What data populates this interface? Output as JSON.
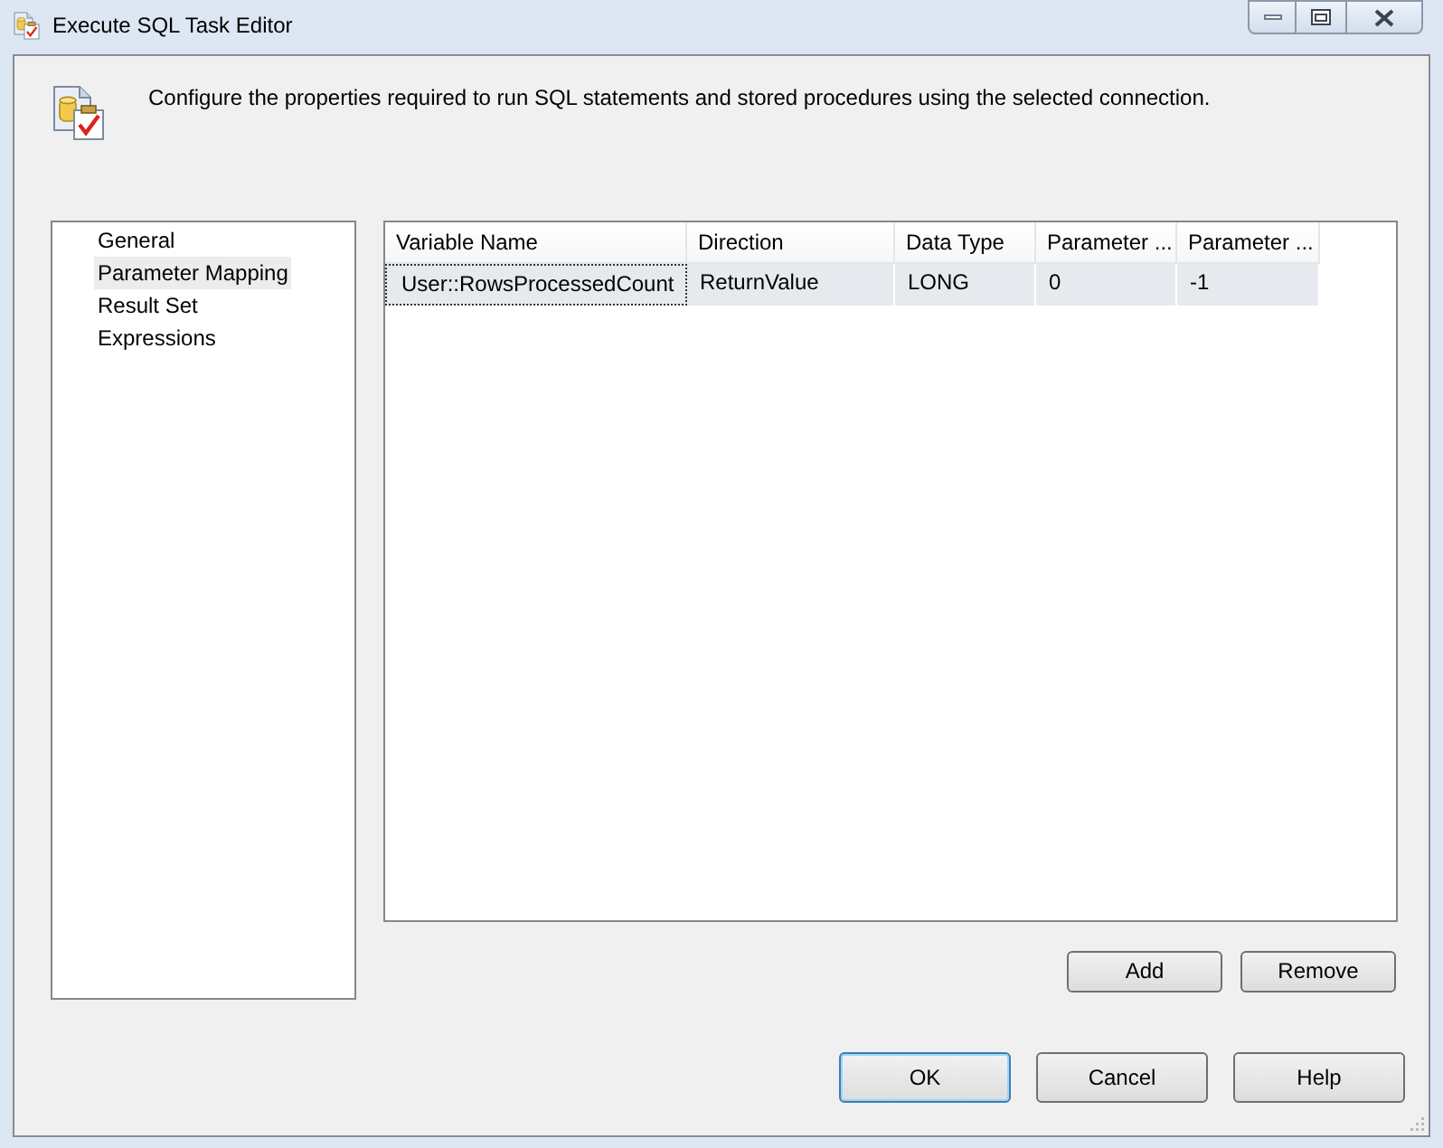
{
  "window": {
    "title": "Execute SQL Task Editor"
  },
  "header": {
    "description": "Configure the properties required to run SQL statements and stored procedures using the selected connection."
  },
  "sidebar": {
    "items": [
      {
        "label": "General",
        "selected": false
      },
      {
        "label": "Parameter Mapping",
        "selected": true
      },
      {
        "label": "Result Set",
        "selected": false
      },
      {
        "label": "Expressions",
        "selected": false
      }
    ]
  },
  "table": {
    "columns": [
      "Variable Name",
      "Direction",
      "Data Type",
      "Parameter ...",
      "Parameter ..."
    ],
    "rows": [
      {
        "cells": [
          "User::RowsProcessedCount",
          "ReturnValue",
          "LONG",
          "0",
          "-1"
        ],
        "selected": true
      }
    ]
  },
  "actions": [
    "Add",
    "Remove"
  ],
  "buttons": [
    {
      "label": "OK",
      "default": true
    },
    {
      "label": "Cancel",
      "default": false
    },
    {
      "label": "Help",
      "default": false
    }
  ]
}
